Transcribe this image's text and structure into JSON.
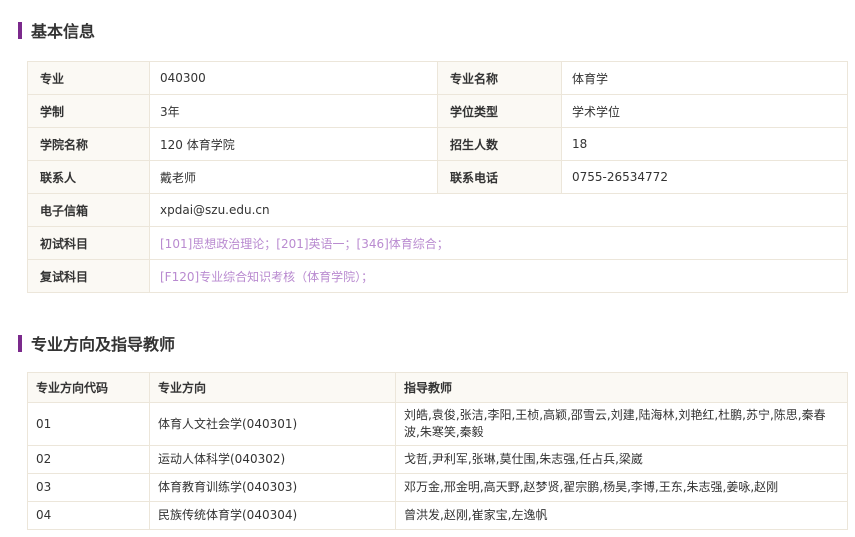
{
  "basic": {
    "title": "基本信息",
    "rows": [
      {
        "l1": "专业",
        "v1": "040300",
        "l2": "专业名称",
        "v2": "体育学"
      },
      {
        "l1": "学制",
        "v1": "3年",
        "l2": "学位类型",
        "v2": "学术学位"
      },
      {
        "l1": "学院名称",
        "v1": "120 体育学院",
        "l2": "招生人数",
        "v2": "18"
      },
      {
        "l1": "联系人",
        "v1": "戴老师",
        "l2": "联系电话",
        "v2": "0755-26534772"
      }
    ],
    "email_label": "电子信箱",
    "email": "xpdai@szu.edu.cn",
    "exam_label": "初试科目",
    "exam_subjects": "[101]思想政治理论；[201]英语一；[346]体育综合；",
    "retest_label": "复试科目",
    "retest_subjects": "[F120]专业综合知识考核（体育学院）；"
  },
  "directions": {
    "title": "专业方向及指导教师",
    "headers": [
      "专业方向代码",
      "专业方向",
      "指导教师"
    ],
    "rows": [
      {
        "code": "01",
        "name": "体育人文社会学(040301)",
        "teachers": "刘皓,袁俊,张洁,李阳,王桢,高颖,邵雪云,刘建,陆海林,刘艳红,杜鹏,苏宁,陈思,秦春波,朱寒笑,秦毅"
      },
      {
        "code": "02",
        "name": "运动人体科学(040302)",
        "teachers": "戈哲,尹利军,张琳,莫仕围,朱志强,任占兵,梁崴"
      },
      {
        "code": "03",
        "name": "体育教育训练学(040303)",
        "teachers": "邓万金,邢金明,高天野,赵梦贤,翟宗鹏,杨昊,李博,王东,朱志强,姜咏,赵刚"
      },
      {
        "code": "04",
        "name": "民族传统体育学(040304)",
        "teachers": "曾洪发,赵刚,崔家宝,左逸帆"
      }
    ]
  },
  "colors": {
    "accent": "#7b2a8c",
    "link": "#b98ad0",
    "label_bg": "#fbf9f4",
    "border": "#ece6da"
  }
}
